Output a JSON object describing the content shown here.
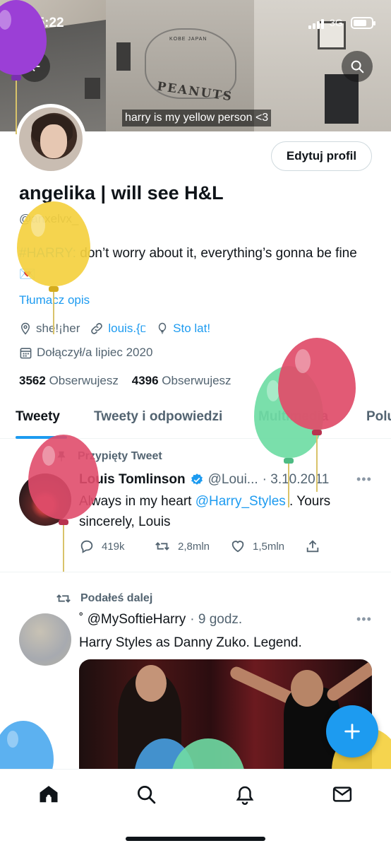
{
  "status_bar": {
    "time": "15:22",
    "network": "3G"
  },
  "banner": {
    "caption": "harry is my yellow person <3",
    "mural_text": "PEANUTS",
    "mural_subtext": "KOBE JAPAN"
  },
  "profile": {
    "display_name": "angelika | will see H&L",
    "handle": "@anxelvx_",
    "bio_hashtag": "#HARRY:",
    "bio_rest": " don’t worry about it, everything’s gonna be fine 💌",
    "translate_label": "Tłumacz opis",
    "pronouns": "she!¡her",
    "link": "louis.{ᥴ",
    "birthday": "Sto lat!",
    "joined": "Dołączył/a lipiec 2020",
    "following_count": "3562",
    "following_label": "Obserwujesz",
    "followers_count": "4396",
    "followers_label": "Obserwujesz",
    "edit_button": "Edytuj profil"
  },
  "tabs": [
    {
      "label": "Tweety",
      "active": true
    },
    {
      "label": "Tweety i odpowiedzi",
      "active": false
    },
    {
      "label": "Multimedia",
      "active": false
    },
    {
      "label": "Polu",
      "active": false
    }
  ],
  "tweets": [
    {
      "context": "Przypięty Tweet",
      "author_name": "Louis Tomlinson",
      "author_handle": "@Loui...",
      "date": "· 3.10.2011",
      "text_before": "Always in my heart ",
      "mention": "@Harry_Styles",
      "text_after": " . Yours sincerely, Louis",
      "replies": "419k",
      "retweets": "2,8mln",
      "likes": "1,5mln"
    },
    {
      "context": "Podałeś dalej",
      "author_handle": "˚ @MySoftieHarry",
      "date": "· 9 godz.",
      "text": "Harry Styles as Danny Zuko. Legend."
    }
  ],
  "colors": {
    "accent": "#1d9bf0",
    "text_primary": "#0f1419",
    "text_secondary": "#536471",
    "balloon_purple": "#9b3fd6",
    "balloon_yellow": "#f4d03f",
    "balloon_pink": "#e04d6b",
    "balloon_green": "#6fdca4",
    "balloon_blue": "#4aa8ee"
  },
  "icons": {
    "back": "arrow-left-icon",
    "search": "search-icon",
    "location": "location-pin-icon",
    "link": "link-icon",
    "birthday": "balloon-icon",
    "calendar": "calendar-icon",
    "pin": "pin-icon",
    "retweet": "retweet-icon",
    "verified": "verified-badge-icon",
    "compose": "plus-icon",
    "nav_home": "home-icon",
    "nav_search": "search-icon",
    "nav_notifications": "bell-icon",
    "nav_messages": "mail-icon"
  }
}
